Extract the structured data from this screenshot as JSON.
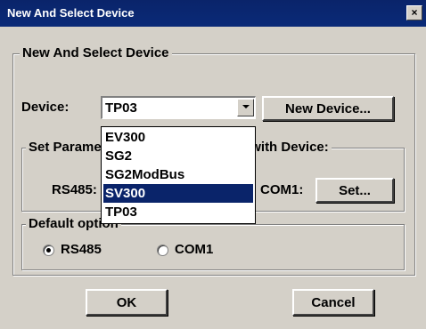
{
  "window": {
    "title": "New And Select Device",
    "close_label": "×"
  },
  "groups": {
    "new_select": {
      "title": "New And Select Device"
    },
    "set_params": {
      "title": "Set Parameters of Communication with Device:"
    },
    "default_option": {
      "title": "Default option"
    }
  },
  "device": {
    "label": "Device:",
    "selected": "TP03",
    "new_device_label": "New Device...",
    "options": [
      "EV300",
      "SG2",
      "SG2ModBus",
      "SV300",
      "TP03"
    ],
    "highlighted": "SV300"
  },
  "comm": {
    "rs485_label": "RS485:",
    "com1_label": "COM1:",
    "set_label": "Set..."
  },
  "default_option": {
    "options": [
      "RS485",
      "COM1"
    ],
    "selected": "RS485"
  },
  "buttons": {
    "ok": "OK",
    "cancel": "Cancel"
  },
  "colors": {
    "title_bar": "#0a246a",
    "face": "#d4d0c8",
    "highlight": "#0a246a"
  }
}
